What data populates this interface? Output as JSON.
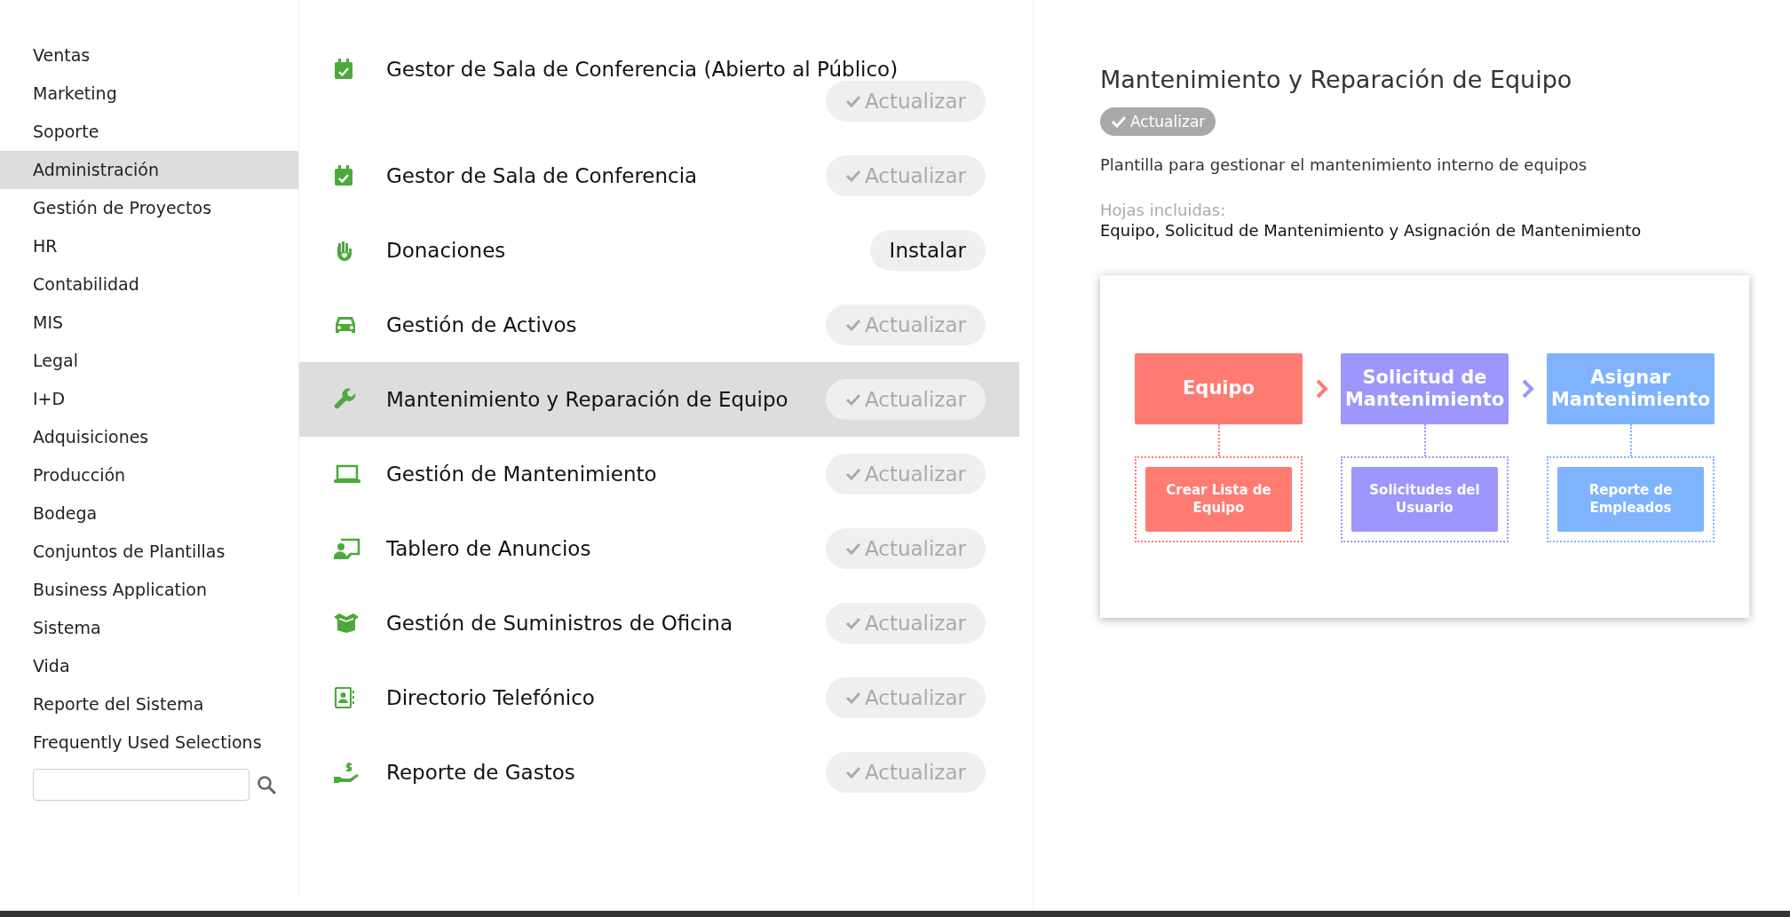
{
  "sidebar": {
    "items": [
      {
        "label": "Ventas",
        "selected": false
      },
      {
        "label": "Marketing",
        "selected": false
      },
      {
        "label": "Soporte",
        "selected": false
      },
      {
        "label": "Administración",
        "selected": true
      },
      {
        "label": "Gestión de Proyectos",
        "selected": false
      },
      {
        "label": "HR",
        "selected": false
      },
      {
        "label": "Contabilidad",
        "selected": false
      },
      {
        "label": "MIS",
        "selected": false
      },
      {
        "label": "Legal",
        "selected": false
      },
      {
        "label": "I+D",
        "selected": false
      },
      {
        "label": "Adquisiciones",
        "selected": false
      },
      {
        "label": "Producción",
        "selected": false
      },
      {
        "label": "Bodega",
        "selected": false
      },
      {
        "label": "Conjuntos de Plantillas",
        "selected": false
      },
      {
        "label": "Business Application",
        "selected": false
      },
      {
        "label": "Sistema",
        "selected": false
      },
      {
        "label": "Vida",
        "selected": false
      },
      {
        "label": "Reporte del Sistema",
        "selected": false
      },
      {
        "label": "Frequently Used Selections",
        "selected": false
      }
    ]
  },
  "templates": [
    {
      "title": "Gestor de Sala de Conferencia (Abierto al Público)",
      "action": {
        "kind": "update",
        "label": "Actualizar"
      },
      "selected": false
    },
    {
      "title": "Gestor de Sala de Conferencia",
      "action": {
        "kind": "update",
        "label": "Actualizar"
      },
      "selected": false
    },
    {
      "title": "Donaciones",
      "action": {
        "kind": "install",
        "label": "Instalar"
      },
      "selected": false
    },
    {
      "title": "Gestión de Activos",
      "action": {
        "kind": "update",
        "label": "Actualizar"
      },
      "selected": false
    },
    {
      "title": "Mantenimiento y Reparación de Equipo",
      "action": {
        "kind": "update",
        "label": "Actualizar"
      },
      "selected": true
    },
    {
      "title": "Gestión de Mantenimiento",
      "action": {
        "kind": "update",
        "label": "Actualizar"
      },
      "selected": false
    },
    {
      "title": "Tablero de Anuncios",
      "action": {
        "kind": "update",
        "label": "Actualizar"
      },
      "selected": false
    },
    {
      "title": "Gestión de Suministros de Oficina",
      "action": {
        "kind": "update",
        "label": "Actualizar"
      },
      "selected": false
    },
    {
      "title": "Directorio Telefónico",
      "action": {
        "kind": "update",
        "label": "Actualizar"
      },
      "selected": false
    },
    {
      "title": "Reporte de Gastos",
      "action": {
        "kind": "update",
        "label": "Actualizar"
      },
      "selected": false
    }
  ],
  "detail": {
    "title": "Mantenimiento y Reparación de Equipo",
    "action": {
      "kind": "update",
      "label": "Actualizar"
    },
    "description": "Plantilla para gestionar el mantenimiento interno de equipos",
    "sheets_label": "Hojas incluidas:",
    "sheets": "Equipo, Solicitud de Mantenimiento y Asignación de Mantenimiento",
    "diagram": [
      {
        "title": "Equipo",
        "sub": "Crear Lista de Equipo",
        "color": "#fe7b72"
      },
      {
        "title": "Solicitud de Mantenimiento",
        "sub": "Solicitudes del Usuario",
        "color": "#9d96fb"
      },
      {
        "title": "Asignar Mantenimiento",
        "sub": "Reporte de Empleados",
        "color": "#7fb3fd"
      }
    ]
  }
}
